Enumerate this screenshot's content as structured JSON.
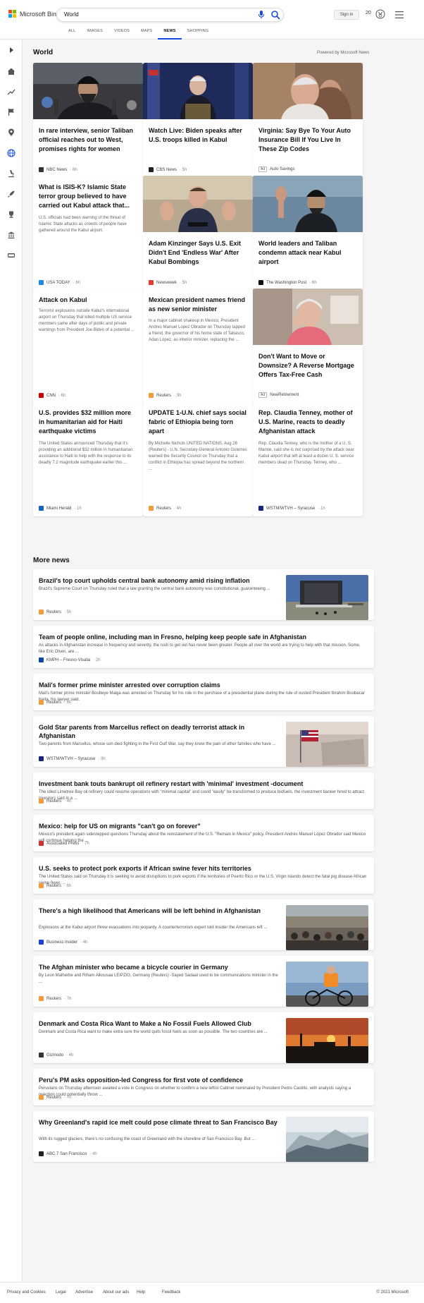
{
  "brand": {
    "name": "Microsoft Bing"
  },
  "search": {
    "value": "World"
  },
  "header": {
    "signin": "Sign in",
    "points": "20"
  },
  "nav": [
    "ALL",
    "IMAGES",
    "VIDEOS",
    "MAPS",
    "NEWS",
    "SHOPPING"
  ],
  "nav_active": "NEWS",
  "section": {
    "title": "World",
    "powered": "Powered by Microsoft News"
  },
  "cards": [
    {
      "title": "In rare interview, senior Taliban official reaches out to West, promises rights for women",
      "desc": "",
      "source": "NBC News",
      "time": "8h",
      "icon_color": "#333333",
      "image": "taliban-press"
    },
    {
      "title": "Watch Live: Biden speaks after U.S. troops killed in Kabul",
      "desc": "",
      "source": "CBS News",
      "time": "5h",
      "icon_color": "#222222",
      "image": "biden-podium"
    },
    {
      "title": "Virginia: Say Bye To Your Auto Insurance Bill If You Live In These Zip Codes",
      "desc": "",
      "source": "Auto Savings",
      "time": "",
      "ad": "Ad",
      "icon_color": "",
      "image": "senior-man"
    },
    {
      "title": "What is ISIS-K? Islamic State terror group believed to have carried out Kabul attack that...",
      "desc": "U.S. officials had been warning of the threat of Islamic State attacks as crowds of people have gathered around the Kabul airport.",
      "source": "USA TODAY",
      "time": "6h",
      "icon_color": "#1e88e5",
      "image": ""
    },
    {
      "title": "Adam Kinzinger Says U.S. Exit Didn't End 'Endless War' After Kabul Bombings",
      "desc": "",
      "source": "Newsweek",
      "time": "5h",
      "icon_color": "#e53935",
      "image": "kinzinger"
    },
    {
      "title": "World leaders and Taliban condemn attack near Kabul airport",
      "desc": "",
      "source": "The Washington Post",
      "time": "6h",
      "icon_color": "#111111",
      "image": "taliban-wave"
    },
    {
      "title": "Attack on Kabul",
      "desc": "Terrorist explosions outside Kabul's international airport on Thursday that killed multiple US service members came after days of public and private warnings from President Joe Biden of a potential ...",
      "source": "CNN",
      "time": "6h",
      "icon_color": "#cc0000",
      "image": ""
    },
    {
      "title": "Mexican president names friend as new senior minister",
      "desc": "In a major cabinet shakeup in Mexico, President Andres Manuel Lopez Obrador on Thursday tapped a friend, the governor of his home state of Tabasco, Adan Lopez, as interior minister, replacing the ...",
      "source": "Reuters",
      "time": "3h",
      "icon_color": "#f39c3c",
      "image": ""
    },
    {
      "title": "Don't Want to Move or Downsize? A Reverse Mortgage Offers Tax-Free Cash",
      "desc": "",
      "source": "NewRetirement",
      "time": "",
      "ad": "Ad",
      "icon_color": "",
      "image": "senior-woman"
    },
    {
      "title": "U.S. provides $32 million more in humanitarian aid for Haiti earthquake victims",
      "desc": "The United States announced Thursday that it's providing an additional $32 million in humanitarian assistance to Haiti to help with the response to its deadly 7.2 magnitude earthquake earlier this ...",
      "source": "Miami Herald",
      "time": "1h",
      "icon_color": "#1565c0",
      "image": ""
    },
    {
      "title": "UPDATE 1-U.N. chief says social fabric of Ethiopia being torn apart",
      "desc": "By Michelle Nichols UNITED NATIONS, Aug 26 (Reuters) - U.N. Secretary-General Antonio Guterres warned the Security Council on Thursday that a conflict in Ethiopia has spread beyond the northern ...",
      "source": "Reuters",
      "time": "4h",
      "icon_color": "#f39c3c",
      "image": ""
    },
    {
      "title": "Rep. Claudia Tenney, mother of U.S. Marine, reacts to deadly Afghanistan attack",
      "desc": "Rep. Claudia Tenney, who is the mother of a U. S. Marine, said she is not surprised by the attack near Kabul airport that left at least a dozen U. S. service members dead on Thursday. Tenney, who ...",
      "source": "WSTM/WTVH – Syracuse",
      "time": "1h",
      "icon_color": "#1a237e",
      "image": ""
    }
  ],
  "more_news": {
    "title": "More news",
    "items": [
      {
        "title": "Brazil's top court upholds central bank autonomy amid rising inflation",
        "desc": "Brazil's Supreme Court on Thursday ruled that a law granting the central bank autonomy was constitutional, guaranteeing ...",
        "source": "Reuters",
        "time": "5h",
        "icon_color": "#f39c3c",
        "image": "bank-building"
      },
      {
        "title": "Team of people online, including man in Fresno, helping keep people safe in Afghanistan",
        "desc": "As attacks in Afghanistan increase in frequency and severity, the rush to get out has never been greater. People all over the world are trying to help with that mission. Some, like Eric Olsen, are ...",
        "source": "KMPH – Fresno-Visalia",
        "time": "2h",
        "icon_color": "#0d47a1",
        "image": ""
      },
      {
        "title": "Mali's former prime minister arrested over corruption claims",
        "desc": "Mali's former prime minister Boubeye Maiga was arrested on Thursday for his role in the purchase of a presidential plane during the rule of ousted President Ibrahim Boubacar Keita, his lawyer said.",
        "source": "Reuters",
        "time": "6h",
        "icon_color": "#f39c3c",
        "image": ""
      },
      {
        "title": "Gold Star parents from Marcellus reflect on deadly terrorist attack in Afghanistan",
        "desc": "Two parents from Marcellus, whose son died fighting in the First Gulf War, say they know the pain of other families who have ...",
        "source": "WSTM/WTVH – Syracuse",
        "time": "3h",
        "icon_color": "#1a237e",
        "image": "memorial-flag"
      },
      {
        "title": "Investment bank touts bankrupt oil refinery restart with 'minimal' investment -document",
        "desc": "The idled Limetree Bay oil refinery could resume operations with \"minimal capital\" and could \"easily\" be transformed to produce biofuels, the investment banker hired to attract investors said in a ...",
        "source": "Reuters",
        "time": "4h",
        "icon_color": "#f39c3c",
        "image": ""
      },
      {
        "title": "Mexico: help for US on migrants \"can't go on forever\"",
        "desc": "Mexico's president again sidestepped questions Thursday about the reinstatement of the U.S. \"Remain in Mexico\" policy. President Andrés Manuel López Obrador said Mexico will continue helping the ...",
        "source": "Associated Press",
        "time": "7h",
        "icon_color": "#d32f2f",
        "image": ""
      },
      {
        "title": "U.S. seeks to protect pork exports if African swine fever hits territories",
        "desc": "The United States said on Thursday it is seeking to avoid disruptions to pork exports if the territories of Puerto Rico or the U.S. Virgin Islands detect the fatal pig disease African swine fever. ...",
        "source": "Reuters",
        "time": "6h",
        "icon_color": "#f39c3c",
        "image": ""
      },
      {
        "title": "There's a high likelihood that Americans will be left behind in Afghanistan",
        "desc": "Explosions at the Kabul airport threw evacuations into jeopardy. A counterterrorism expert told Insider the Americans left ...",
        "source": "Business Insider",
        "time": "4h",
        "icon_color": "#1e40d8",
        "image": "kabul-crowd"
      },
      {
        "title": "The Afghan minister who became a bicycle courier in Germany",
        "desc": "By Leon Malherbe and Riham Alkousaa LEIPZIG, Germany (Reuters) -Sayed Sadaat used to be communications minister in the ...",
        "source": "Reuters",
        "time": "7h",
        "icon_color": "#f39c3c",
        "image": "courier"
      },
      {
        "title": "Denmark and Costa Rica Want to Make a No Fossil Fuels Allowed Club",
        "desc": "Denmark and Costa Rica want to make extra sure the world quits fossil fuels as soon as possible. The two countries are ...",
        "source": "Gizmodo",
        "time": "4h",
        "icon_color": "#333333",
        "image": "refinery-sunset"
      },
      {
        "title": "Peru's PM asks opposition-led Congress for first vote of confidence",
        "desc": "Peruvians on Thursday afternoon awaited a vote in Congress on whether to confirm a new leftist Cabinet nominated by President Pedro Castillo, with analysts saying a rejection could potentially throw ...",
        "source": "Reuters",
        "time": "7h",
        "icon_color": "#f39c3c",
        "image": ""
      },
      {
        "title": "Why Greenland's rapid ice melt could pose climate threat to San Francisco Bay",
        "desc": "With its rugged glaciers, there's no confusing the coast of Greenland with the shoreline of San Francisco Bay. But ...",
        "source": "ABC 7 San Francisco",
        "time": "4h",
        "icon_color": "#222222",
        "image": "glacier"
      }
    ]
  },
  "footer": {
    "links": [
      "Privacy and Cookies",
      "Legal",
      "Advertise",
      "About our ads",
      "Help",
      "Feedback"
    ],
    "copyright": "© 2021 Microsoft"
  },
  "colors": {
    "accent": "#174ae4",
    "ms_red": "#f25022",
    "ms_green": "#7fba00",
    "ms_blue": "#00a4ef",
    "ms_yellow": "#ffb900"
  }
}
